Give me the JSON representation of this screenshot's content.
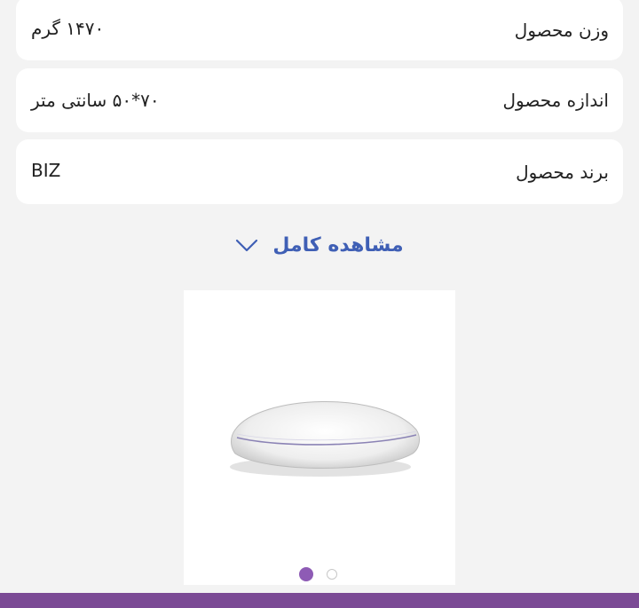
{
  "specs": [
    {
      "label": "وزن محصول",
      "value": "۱۴۷۰ گرم"
    },
    {
      "label": "اندازه محصول",
      "value": "۷۰*۵۰ سانتی متر"
    },
    {
      "label": "برند محصول",
      "value": "BIZ"
    }
  ],
  "view_full_label": "مشاهده کامل",
  "view_full_icon": "chevron-down-icon",
  "gallery": {
    "image": "white-pillow",
    "pages": 2,
    "active_page": 1
  },
  "colors": {
    "background": "#f3f3f3",
    "card": "#ffffff",
    "link": "#3f5fb5",
    "dot_active": "#8e5bb5",
    "bottom_bar": "#7b4a95"
  }
}
